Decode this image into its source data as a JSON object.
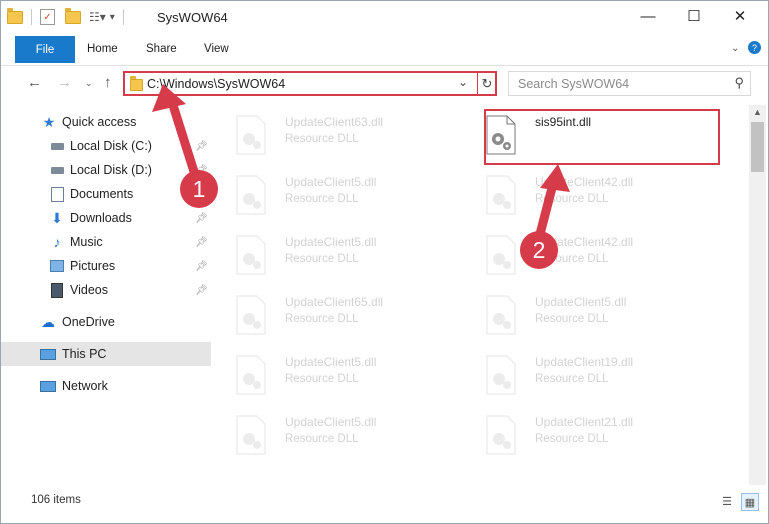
{
  "window": {
    "title": "SysWOW64",
    "minimize": "—",
    "maximize": "☐",
    "close": "✕"
  },
  "ribbon": {
    "tabs": [
      "File",
      "Home",
      "Share",
      "View"
    ]
  },
  "address": {
    "path": "C:\\Windows\\SysWOW64",
    "search_placeholder": "Search SysWOW64"
  },
  "nav": {
    "items": [
      {
        "label": "Quick access",
        "icon": "star-icon"
      },
      {
        "label": "Local Disk (C:)",
        "icon": "drive-icon",
        "pinned": true
      },
      {
        "label": "Local Disk (D:)",
        "icon": "drive-icon",
        "pinned": true
      },
      {
        "label": "Documents",
        "icon": "documents-icon",
        "pinned": true
      },
      {
        "label": "Downloads",
        "icon": "download-icon",
        "pinned": true
      },
      {
        "label": "Music",
        "icon": "music-icon",
        "pinned": true
      },
      {
        "label": "Pictures",
        "icon": "pictures-icon",
        "pinned": true
      },
      {
        "label": "Videos",
        "icon": "videos-icon",
        "pinned": true
      },
      {
        "label": "OneDrive",
        "icon": "cloud-icon"
      },
      {
        "label": "This PC",
        "icon": "computer-icon",
        "selected": true
      },
      {
        "label": "Network",
        "icon": "network-icon"
      }
    ]
  },
  "files": {
    "col1": [
      {
        "name": "UpdateClient63.dll",
        "type": "Resource DLL"
      },
      {
        "name": "UpdateClient5.dll",
        "type": "Resource DLL"
      },
      {
        "name": "UpdateClient5.dll",
        "type": "Resource DLL"
      },
      {
        "name": "UpdateClient65.dll",
        "type": "Resource DLL"
      },
      {
        "name": "UpdateClient5.dll",
        "type": "Resource DLL"
      },
      {
        "name": "UpdateClient5.dll",
        "type": "Resource DLL"
      }
    ],
    "col2": [
      {
        "name": "sis95int.dll",
        "type": "",
        "highlighted": true
      },
      {
        "name": "UpdateClient42.dll",
        "type": "Resource DLL"
      },
      {
        "name": "UpdateClient42.dll",
        "type": "Resource DLL"
      },
      {
        "name": "UpdateClient5.dll",
        "type": "Resource DLL"
      },
      {
        "name": "UpdateClient19.dll",
        "type": "Resource DLL"
      },
      {
        "name": "UpdateClient21.dll",
        "type": "Resource DLL"
      }
    ]
  },
  "status": {
    "item_count": "106 items"
  },
  "annotations": {
    "step1": "1",
    "step2": "2",
    "color": "#d63b4a"
  },
  "colors": {
    "file_tab": "#1979ca",
    "highlight": "#d63b4a",
    "folder": "#f4c64e"
  }
}
